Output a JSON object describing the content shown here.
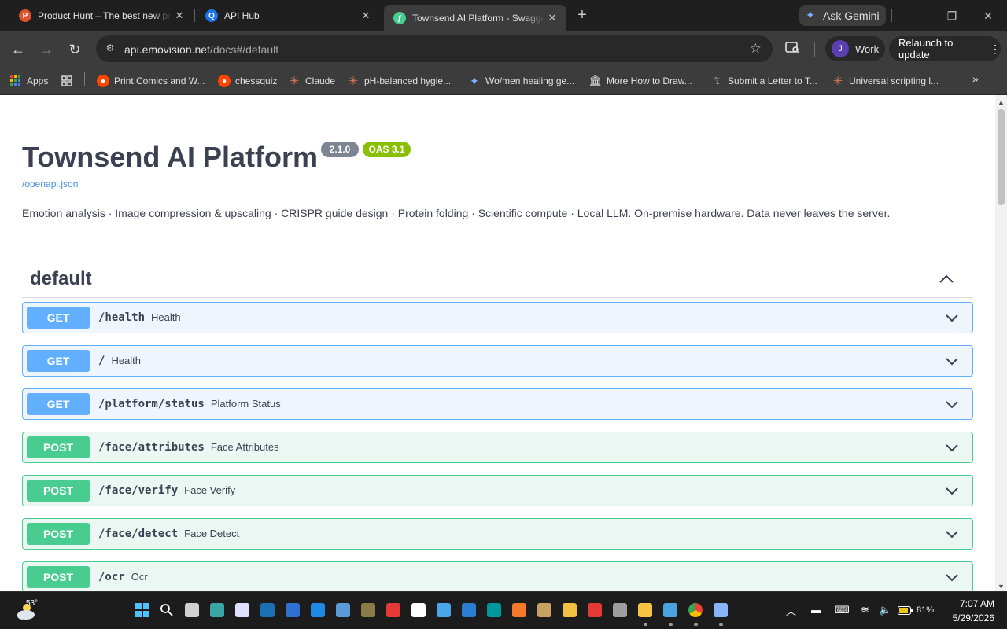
{
  "tabs": [
    {
      "title": "Product Hunt – The best new products in tech",
      "favicon": "product-hunt-icon",
      "color": "#da552f",
      "glyph": "P"
    },
    {
      "title": "API Hub",
      "favicon": "rapidapi-hub-icon",
      "color": "#1a73e8",
      "glyph": "Q"
    },
    {
      "title": "Townsend AI Platform - Swagger UI",
      "favicon": "swagger-icon",
      "color": "#49cc90",
      "glyph": "ƒ"
    }
  ],
  "tabstrip": {
    "new_tab": "+",
    "gemini_label": "Ask Gemini",
    "minimize": "—",
    "restore": "❐",
    "close": "✕"
  },
  "toolbar": {
    "back": "←",
    "forward": "→",
    "reload": "↻",
    "url_host": "api.emovision.net",
    "url_path": "/docs#/default",
    "profile_initial": "J",
    "profile_label": "Work",
    "relaunch_label": "Relaunch to update",
    "menu": "⋮"
  },
  "bookmarks": [
    {
      "label": "Apps",
      "icon": "apps-grid-icon",
      "color": "#fbbc04"
    },
    {
      "label": "",
      "icon": "tab-groups-icon",
      "color": "#e3e3e3"
    },
    {
      "label": "Print Comics and W...",
      "icon": "reddit-icon",
      "color": "#ff4500"
    },
    {
      "label": "chessquiz",
      "icon": "reddit-icon",
      "color": "#ff4500"
    },
    {
      "label": "Claude",
      "icon": "claude-icon",
      "color": "#d97757"
    },
    {
      "label": "pH-balanced hygie...",
      "icon": "claude-icon",
      "color": "#d97757"
    },
    {
      "label": "Wo/men healing ge...",
      "icon": "gemini-icon",
      "color": "#7fb2ff"
    },
    {
      "label": "More How to Draw...",
      "icon": "library-icon",
      "color": "#e3e3e3"
    },
    {
      "label": "Submit a Letter to T...",
      "icon": "nytimes-icon",
      "color": "#e3e3e3"
    },
    {
      "label": "Universal scripting l...",
      "icon": "claude-icon",
      "color": "#d97757"
    }
  ],
  "bookmarks_more": "»",
  "swagger": {
    "title": "Townsend AI Platform",
    "version": "2.1.0",
    "oas": "OAS 3.1",
    "spec_link": "/openapi.json",
    "description": "Emotion analysis · Image compression & upscaling · CRISPR guide design · Protein folding · Scientific compute · Local LLM. On-premise hardware. Data never leaves the server.",
    "tag": "default",
    "colors": {
      "get": "#61affe",
      "post": "#49cc90",
      "text": "#3b4151"
    },
    "operations": [
      {
        "method": "GET",
        "path": "/health",
        "summary": "Health"
      },
      {
        "method": "GET",
        "path": "/",
        "summary": "Health"
      },
      {
        "method": "GET",
        "path": "/platform/status",
        "summary": "Platform Status"
      },
      {
        "method": "POST",
        "path": "/face/attributes",
        "summary": "Face Attributes"
      },
      {
        "method": "POST",
        "path": "/face/verify",
        "summary": "Face Verify"
      },
      {
        "method": "POST",
        "path": "/face/detect",
        "summary": "Face Detect"
      },
      {
        "method": "POST",
        "path": "/ocr",
        "summary": "Ocr"
      }
    ]
  },
  "taskbar": {
    "weather_temp": "53°",
    "battery": "81%",
    "time": "7:07 AM",
    "date": "5/29/2026",
    "apps": [
      {
        "name": "windows-start-icon",
        "color": "#4cc2ff"
      },
      {
        "name": "search-icon",
        "color": "#ffffff"
      },
      {
        "name": "task-view-icon",
        "color": "#d0d0d0"
      },
      {
        "name": "widgets-icon",
        "color": "#3aa6a6"
      },
      {
        "name": "snipping-tool-icon",
        "color": "#e0e0ff"
      },
      {
        "name": "steam-icon",
        "color": "#1b6fb3"
      },
      {
        "name": "powershell-icon",
        "color": "#2f6fd1"
      },
      {
        "name": "remote-desktop-icon",
        "color": "#1e88e5"
      },
      {
        "name": "settings-app-icon",
        "color": "#5b9bd5"
      },
      {
        "name": "gimp-icon",
        "color": "#8a7b47"
      },
      {
        "name": "arc-icon",
        "color": "#e53935"
      },
      {
        "name": "chatgpt-icon",
        "color": "#ffffff"
      },
      {
        "name": "photos-icon",
        "color": "#48a7e6"
      },
      {
        "name": "word-icon",
        "color": "#2b7cd3"
      },
      {
        "name": "arduino-icon",
        "color": "#00979d"
      },
      {
        "name": "blender-icon",
        "color": "#f5792a"
      },
      {
        "name": "game-icon",
        "color": "#c8a060"
      },
      {
        "name": "paint-icon",
        "color": "#f0c040"
      },
      {
        "name": "red-app-icon",
        "color": "#e53935"
      },
      {
        "name": "terminal-icon",
        "color": "#9e9e9e"
      },
      {
        "name": "file-explorer-icon",
        "color": "#f6c343"
      },
      {
        "name": "notepad-icon",
        "color": "#4aa3df"
      },
      {
        "name": "chrome-icon",
        "color": "#34a853"
      },
      {
        "name": "devices-icon",
        "color": "#8ab4f8"
      }
    ]
  }
}
